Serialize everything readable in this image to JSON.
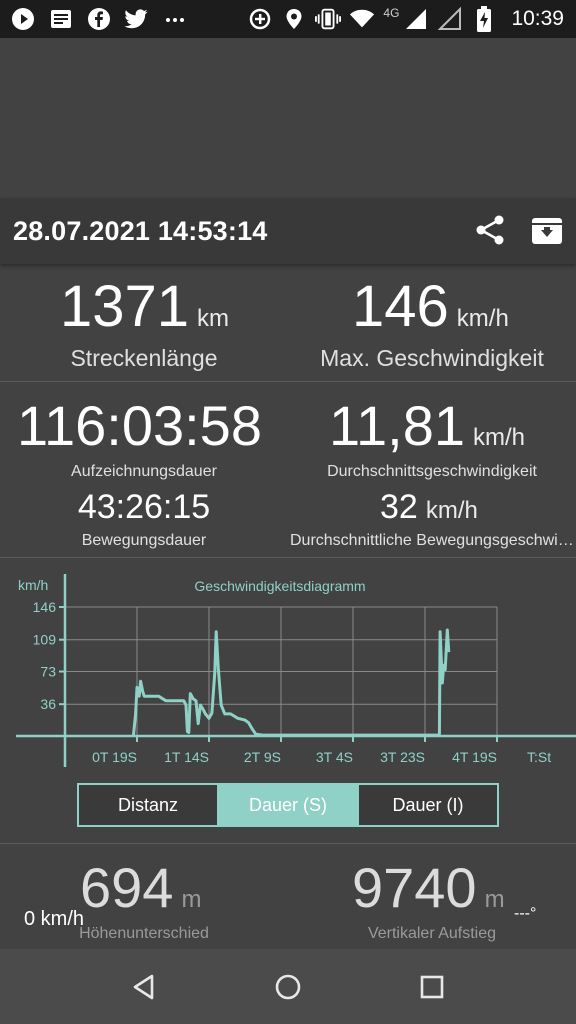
{
  "status_bar": {
    "time": "10:39",
    "network": "4G",
    "icons": [
      "play-icon",
      "news-icon",
      "facebook-icon",
      "twitter-icon",
      "more-dots-icon",
      "data-saver-icon",
      "location-icon",
      "vibrate-icon",
      "wifi-icon",
      "signal-icon",
      "signal-empty-icon",
      "battery-charging-icon"
    ]
  },
  "header": {
    "title": "28.07.2021 14:53:14",
    "icons": [
      "share-icon",
      "archive-icon"
    ]
  },
  "stats": {
    "distance": {
      "value": "1371",
      "unit": "km",
      "label": "Streckenlänge"
    },
    "max_speed": {
      "value": "146",
      "unit": "km/h",
      "label": "Max. Geschwindigkeit"
    },
    "record_duration": {
      "value": "116:03:58",
      "label": "Aufzeichnungsdauer"
    },
    "avg_speed": {
      "value": "11,81",
      "unit": "km/h",
      "label": "Durchschnittsgeschwindigkeit"
    },
    "moving_duration": {
      "value": "43:26:15",
      "label": "Bewegungsdauer"
    },
    "avg_moving_speed": {
      "value": "32",
      "unit": "km/h",
      "label": "Durchschnittliche Bewegungsgeschwi…"
    }
  },
  "chart_data": {
    "type": "line",
    "title": "Geschwindigkeitsdiagramm",
    "ylabel": "km/h",
    "xlabel": "T:St",
    "y_ticks": [
      "146",
      "109",
      "73",
      "36"
    ],
    "x_ticks": [
      "0T 19S",
      "1T 14S",
      "2T 9S",
      "3T 4S",
      "3T 23S",
      "4T 19S"
    ],
    "ylim": [
      0,
      146
    ],
    "series": [
      {
        "color": "#8fd1c6",
        "points": [
          [
            -0.05,
            0
          ],
          [
            -0.02,
            25
          ],
          [
            0.0,
            55
          ],
          [
            0.03,
            45
          ],
          [
            0.05,
            62
          ],
          [
            0.08,
            50
          ],
          [
            0.1,
            45
          ],
          [
            0.2,
            45
          ],
          [
            0.3,
            45
          ],
          [
            0.4,
            40
          ],
          [
            0.5,
            40
          ],
          [
            0.6,
            40
          ],
          [
            0.65,
            40
          ],
          [
            0.68,
            35
          ],
          [
            0.7,
            5
          ],
          [
            0.72,
            4
          ],
          [
            0.74,
            48
          ],
          [
            0.78,
            42
          ],
          [
            0.82,
            40
          ],
          [
            0.85,
            14
          ],
          [
            0.88,
            35
          ],
          [
            0.92,
            30
          ],
          [
            0.95,
            25
          ],
          [
            1.0,
            20
          ],
          [
            1.04,
            26
          ],
          [
            1.08,
            72
          ],
          [
            1.1,
            118
          ],
          [
            1.13,
            75
          ],
          [
            1.17,
            35
          ],
          [
            1.22,
            25
          ],
          [
            1.3,
            25
          ],
          [
            1.4,
            20
          ],
          [
            1.5,
            18
          ],
          [
            1.55,
            15
          ],
          [
            1.6,
            8
          ],
          [
            1.65,
            2
          ],
          [
            1.75,
            1
          ],
          [
            2.0,
            1
          ],
          [
            2.5,
            1
          ],
          [
            3.0,
            1
          ],
          [
            3.5,
            1
          ],
          [
            4.0,
            1
          ],
          [
            4.18,
            1
          ],
          [
            4.2,
            2
          ],
          [
            4.21,
            118
          ],
          [
            4.24,
            60
          ],
          [
            4.26,
            80
          ],
          [
            4.28,
            75
          ],
          [
            4.31,
            120
          ],
          [
            4.33,
            95
          ]
        ]
      }
    ]
  },
  "toggle": {
    "options": [
      "Distanz",
      "Dauer (S)",
      "Dauer (I)"
    ],
    "selected": "Dauer (S)"
  },
  "bottom_stats": {
    "elevation_diff": {
      "value": "694",
      "unit": "m",
      "label": "Höhenunterschied"
    },
    "vertical_climb": {
      "value": "9740",
      "unit": "m",
      "label": "Vertikaler Aufstieg"
    },
    "current_speed": "0 km/h",
    "heading": "---°"
  },
  "nav": {
    "icons": [
      "back-icon",
      "home-icon",
      "recents-icon"
    ]
  },
  "colors": {
    "accent": "#8fd1c6",
    "background": "#424242",
    "header": "#393939",
    "statusbar": "#1c1c1c"
  }
}
